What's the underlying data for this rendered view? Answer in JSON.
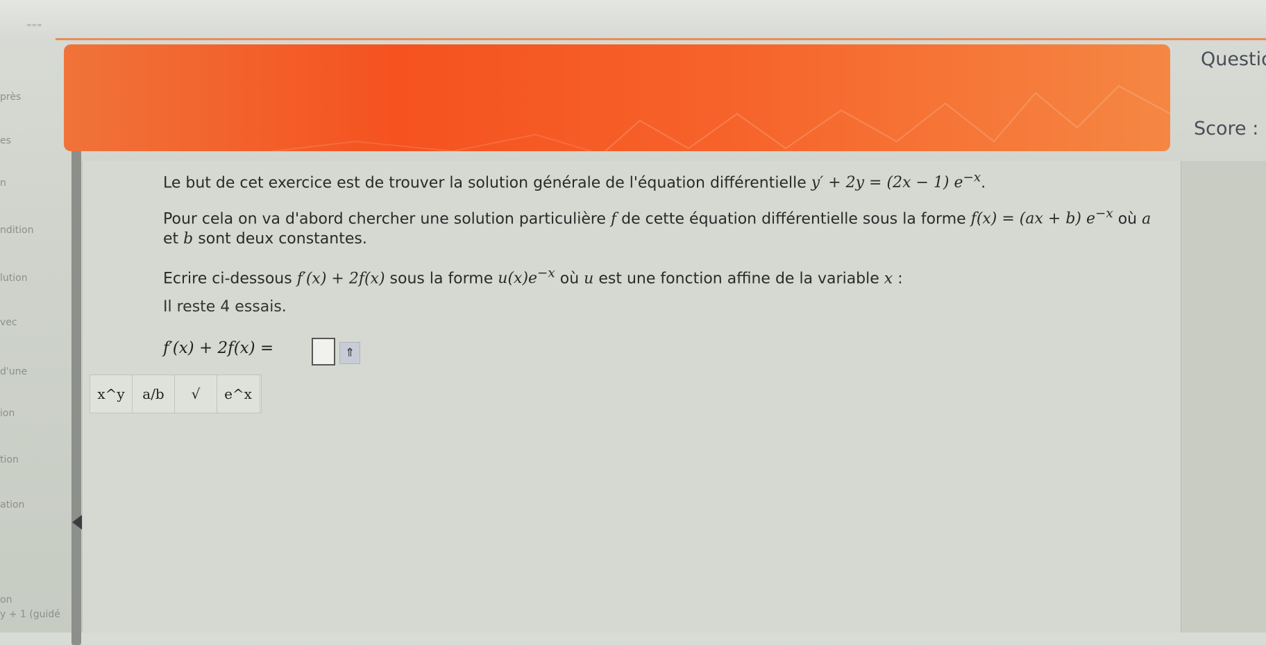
{
  "top": {
    "mark": "≈≈≈"
  },
  "nav": {
    "items": [
      "près",
      "es",
      "n",
      "ndition",
      "lution",
      "vec",
      "d'une",
      "ion",
      "tion",
      "ation",
      "on",
      "y + 1 (guidé"
    ]
  },
  "header": {
    "question_label": "Questio",
    "score_label": "Score :"
  },
  "exercise": {
    "line1_text": "Le but de cet exercice est de trouver la solution générale de l'équation différentielle",
    "line1_math": "y′ + 2y = (2x − 1) e",
    "line1_exp": "−x",
    "line2_text": "Pour cela on va d'abord chercher une solution particulière",
    "line2_f": "f",
    "line2_text2": "de cette équation différentielle sous la forme",
    "line2_math": "f(x) = (ax + b) e",
    "line2_exp": "−x",
    "line2_text3": "où",
    "line2_a": "a",
    "line3_text": "et",
    "line3_b": "b",
    "line3_text2": "sont deux constantes.",
    "line4_text": "Ecrire ci-dessous",
    "line4_math": "f′(x) + 2f(x)",
    "line4_text2": "sous la forme",
    "line4_math2": "u(x)e",
    "line4_exp": "−x",
    "line4_text3": "où",
    "line4_u": "u",
    "line4_text4": "est une fonction affine de la variable",
    "line4_x": "x",
    "line4_colon": ":"
  },
  "answer": {
    "attempts": "Il reste 4 essais.",
    "label": "f′(x) + 2f(x) =",
    "submit_icon": "⇑"
  },
  "toolbar": {
    "power": "x^y",
    "fraction": "a/b",
    "sqrt": "√",
    "exp": "e^x"
  }
}
